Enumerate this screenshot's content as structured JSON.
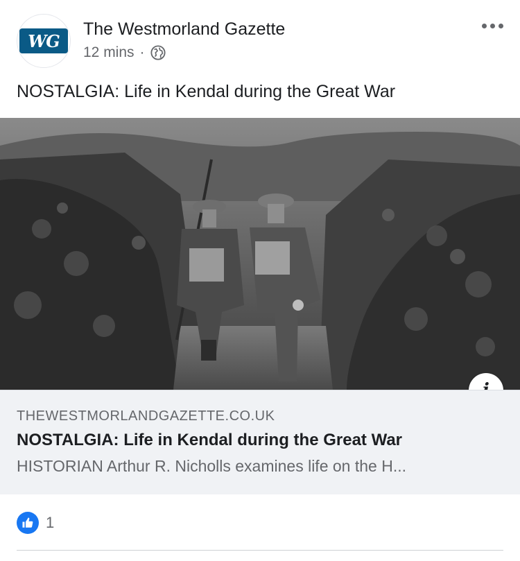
{
  "post": {
    "page_name": "The Westmorland Gazette",
    "avatar_text": "WG",
    "time": "12 mins",
    "separator": "·",
    "privacy_icon": "globe-icon",
    "more_icon": "more-options-icon",
    "text": "NOSTALGIA: Life in Kendal during the Great War"
  },
  "link": {
    "domain": "THEWESTMORLANDGAZETTE.CO.UK",
    "title": "NOSTALGIA: Life in Kendal during the Great War",
    "description": "HISTORIAN Arthur R. Nicholls examines life on the H...",
    "info_icon_label": "i",
    "image_icon": "historical-photo"
  },
  "reactions": {
    "icon": "like-icon",
    "count": "1"
  },
  "colors": {
    "accent": "#1877f2",
    "avatar_bg": "#0a5a86",
    "secondary_text": "#65676b",
    "card_bg": "#f0f2f5"
  }
}
